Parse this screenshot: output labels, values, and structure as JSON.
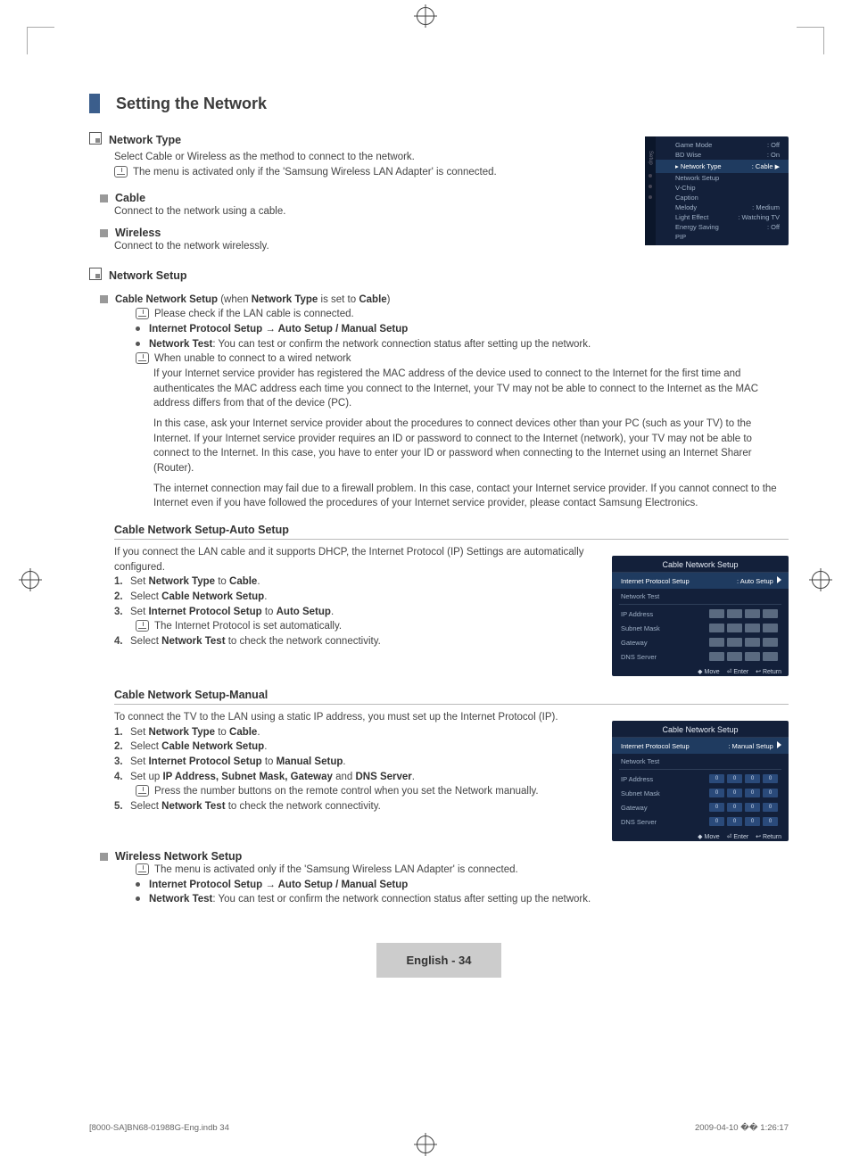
{
  "header": {
    "title": "Setting the Network"
  },
  "network_type": {
    "title": "Network Type",
    "desc": "Select Cable or Wireless as the method to connect to the network.",
    "note": "The menu is activated only if the 'Samsung Wireless LAN Adapter' is connected.",
    "cable_title": "Cable",
    "cable_desc": "Connect to the network using a cable.",
    "wireless_title": "Wireless",
    "wireless_desc": "Connect to the network wirelessly."
  },
  "network_setup": {
    "title": "Network Setup",
    "cable_line_a": "Cable Network Setup",
    "cable_line_b": " (when ",
    "cable_line_c": "Network Type",
    "cable_line_d": " is set to ",
    "cable_line_e": "Cable",
    "cable_line_f": ")",
    "note1": "Please check if the LAN cable is connected.",
    "proto_line_a": "Internet Protocol Setup → Auto Setup / Manual Setup",
    "test_a": "Network Test",
    "test_b": ": You can test or confirm the network connection status after setting up the network.",
    "note2": "When unable to connect to a wired network",
    "p1": "If your Internet service provider has registered the MAC address of the device used to connect to the Internet for the first time and authenticates the MAC address each time you connect to the Internet, your TV may not be able to connect to the Internet as the MAC address differs from that of the device (PC).",
    "p2": "In this case, ask your Internet service provider about the procedures to connect devices other than your PC (such as your TV) to the Internet. If your Internet service provider requires an ID or password to connect to the Internet (network), your TV may not be able to connect to the Internet. In this case, you have to enter your ID or password when connecting to the Internet using an Internet Sharer (Router).",
    "p3": "The internet connection may fail due to a firewall problem. In this case, contact your Internet service provider. If you cannot connect to the Internet even if you have followed the procedures of your Internet service provider, please contact Samsung Electronics."
  },
  "auto": {
    "heading": "Cable Network Setup-Auto Setup",
    "intro": "If you connect the LAN cable and it supports DHCP, the Internet Protocol (IP) Settings are automatically configured.",
    "s1a": "Set ",
    "s1b": "Network Type",
    "s1c": " to ",
    "s1d": "Cable",
    "s1e": ".",
    "s2a": "Select ",
    "s2b": "Cable Network Setup",
    "s2c": ".",
    "s3a": "Set ",
    "s3b": "Internet Protocol Setup",
    "s3c": " to ",
    "s3d": "Auto Setup",
    "s3e": ".",
    "s3note": "The Internet Protocol is set automatically.",
    "s4a": "Select ",
    "s4b": "Network Test",
    "s4c": " to check the network connectivity."
  },
  "manual": {
    "heading": "Cable Network Setup-Manual",
    "intro": "To connect the TV to the LAN using a static IP address, you must set up the Internet Protocol (IP).",
    "s1a": "Set ",
    "s1b": "Network Type",
    "s1c": " to ",
    "s1d": "Cable",
    "s1e": ".",
    "s2a": "Select ",
    "s2b": "Cable Network Setup",
    "s2c": ".",
    "s3a": "Set ",
    "s3b": "Internet Protocol Setup",
    "s3c": " to ",
    "s3d": "Manual Setup",
    "s3e": ".",
    "s4a": "Set up ",
    "s4b": "IP Address, Subnet Mask, Gateway",
    "s4c": " and ",
    "s4d": "DNS Server",
    "s4e": ".",
    "s4note": "Press the number buttons on the remote control when you set the Network manually.",
    "s5a": "Select ",
    "s5b": "Network Test",
    "s5c": " to check the network connectivity."
  },
  "wireless_setup": {
    "heading": "Wireless Network Setup",
    "note": "The menu is activated only if the 'Samsung Wireless LAN Adapter' is connected.",
    "proto": "Internet Protocol Setup → Auto Setup / Manual Setup",
    "test_a": "Network Test",
    "test_b": ": You can test or confirm the network connection status after setting up the network."
  },
  "osd1": {
    "side_label": "Setup",
    "items": [
      [
        "Game Mode",
        ": Off"
      ],
      [
        "BD Wise",
        ": On"
      ],
      [
        "▸ Network Type",
        ": Cable"
      ],
      [
        "Network Setup",
        ""
      ],
      [
        "V-Chip",
        ""
      ],
      [
        "Caption",
        ""
      ],
      [
        "Melody",
        ": Medium"
      ],
      [
        "Light Effect",
        ": Watching TV"
      ],
      [
        "Energy Saving",
        ": Off"
      ],
      [
        "PIP",
        ""
      ]
    ],
    "hl_index": 2
  },
  "osd_auto": {
    "title": "Cable Network Setup",
    "proto_label": "Internet Protocol Setup",
    "proto_value": ": Auto Setup",
    "test_label": "Network Test",
    "fields": [
      "IP Address",
      "Subnet Mask",
      "Gateway",
      "DNS Server"
    ],
    "nav": [
      "◆ Move",
      "⏎ Enter",
      "↩ Return"
    ]
  },
  "osd_manual": {
    "title": "Cable Network Setup",
    "proto_label": "Internet Protocol Setup",
    "proto_value": ": Manual Setup",
    "test_label": "Network Test",
    "fields": [
      "IP Address",
      "Subnet Mask",
      "Gateway",
      "DNS Server"
    ],
    "vals": [
      [
        "0",
        "0",
        "0",
        "0"
      ],
      [
        "0",
        "0",
        "0",
        "0"
      ],
      [
        "0",
        "0",
        "0",
        "0"
      ],
      [
        "0",
        "0",
        "0",
        "0"
      ]
    ],
    "nav": [
      "◆ Move",
      "⏎ Enter",
      "↩ Return"
    ]
  },
  "footer": {
    "lang": "English - 34",
    "left": "[8000-SA]BN68-01988G-Eng.indb   34",
    "right": "2009-04-10   �� 1:26:17"
  }
}
